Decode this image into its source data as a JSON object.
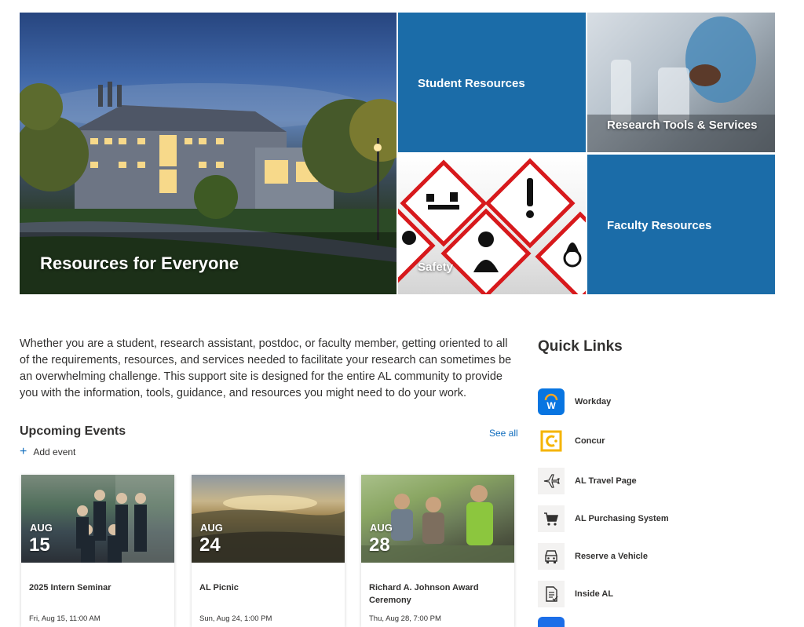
{
  "hero": {
    "main_label": "Resources for Everyone",
    "tiles": [
      {
        "label": "Student Resources"
      },
      {
        "label": "Research Tools & Services"
      },
      {
        "label": "Safety"
      },
      {
        "label": "Faculty Resources"
      }
    ]
  },
  "intro": {
    "text": "Whether you are a student, research assistant, postdoc, or faculty member, getting oriented to all of the requirements, resources, and services needed to facilitate your research can sometimes be an overwhelming challenge.  This support site is designed for the entire AL community to provide you with the information, tools, guidance, and resources you might need to do your work."
  },
  "events": {
    "title": "Upcoming Events",
    "see_all": "See all",
    "add_event": "Add event",
    "items": [
      {
        "month": "AUG",
        "day": "15",
        "title": "2025 Intern Seminar",
        "date": "Fri, Aug 15, 11:00 AM"
      },
      {
        "month": "AUG",
        "day": "24",
        "title": "AL Picnic",
        "date": "Sun, Aug 24, 1:00 PM"
      },
      {
        "month": "AUG",
        "day": "28",
        "title": "Richard A. Johnson Award Ceremony",
        "date": "Thu, Aug 28, 7:00 PM"
      }
    ]
  },
  "quick_links": {
    "title": "Quick Links",
    "items": [
      {
        "label": "Workday",
        "icon": "workday-logo-icon"
      },
      {
        "label": "Concur",
        "icon": "concur-logo-icon"
      },
      {
        "label": "AL Travel Page",
        "icon": "airplane-icon"
      },
      {
        "label": "AL Purchasing System",
        "icon": "shopping-cart-icon"
      },
      {
        "label": "Reserve a Vehicle",
        "icon": "vehicle-icon"
      },
      {
        "label": "Inside AL",
        "icon": "document-icon"
      }
    ]
  },
  "colors": {
    "accent": "#1b6ca8",
    "link": "#0f6cbd",
    "workday": "#0875e1",
    "concur": "#f5b400",
    "safety_red": "#d7191c"
  }
}
